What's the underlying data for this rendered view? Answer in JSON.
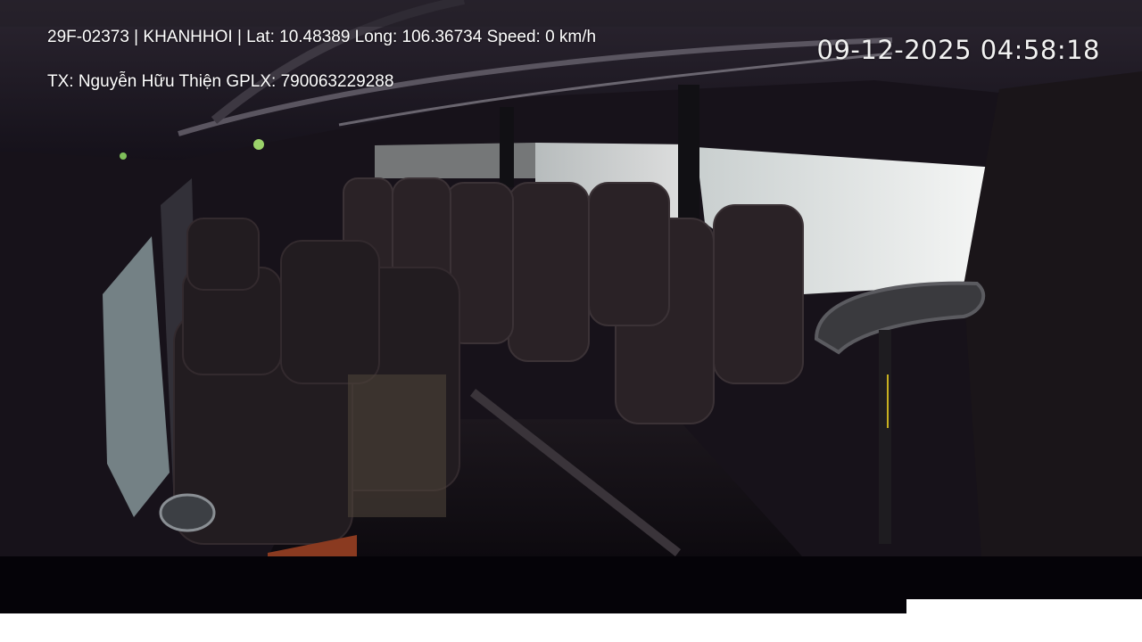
{
  "overlay": {
    "line1": "29F-02373 | KHANHHOI | Lat: 10.48389 Long: 106.36734 Speed: 0 km/h",
    "line2": "TX: Nguyễn Hữu Thiện GPLX: 790063229288",
    "datetime": "09-12-2025 04:58:18"
  },
  "scene": {
    "description_icon": "bus-interior-camera-view",
    "colors": {
      "interior_dark": "#17121a",
      "window_light": "#f0f2f2",
      "seat": "#2a2226",
      "letterbox": "#050308"
    }
  }
}
